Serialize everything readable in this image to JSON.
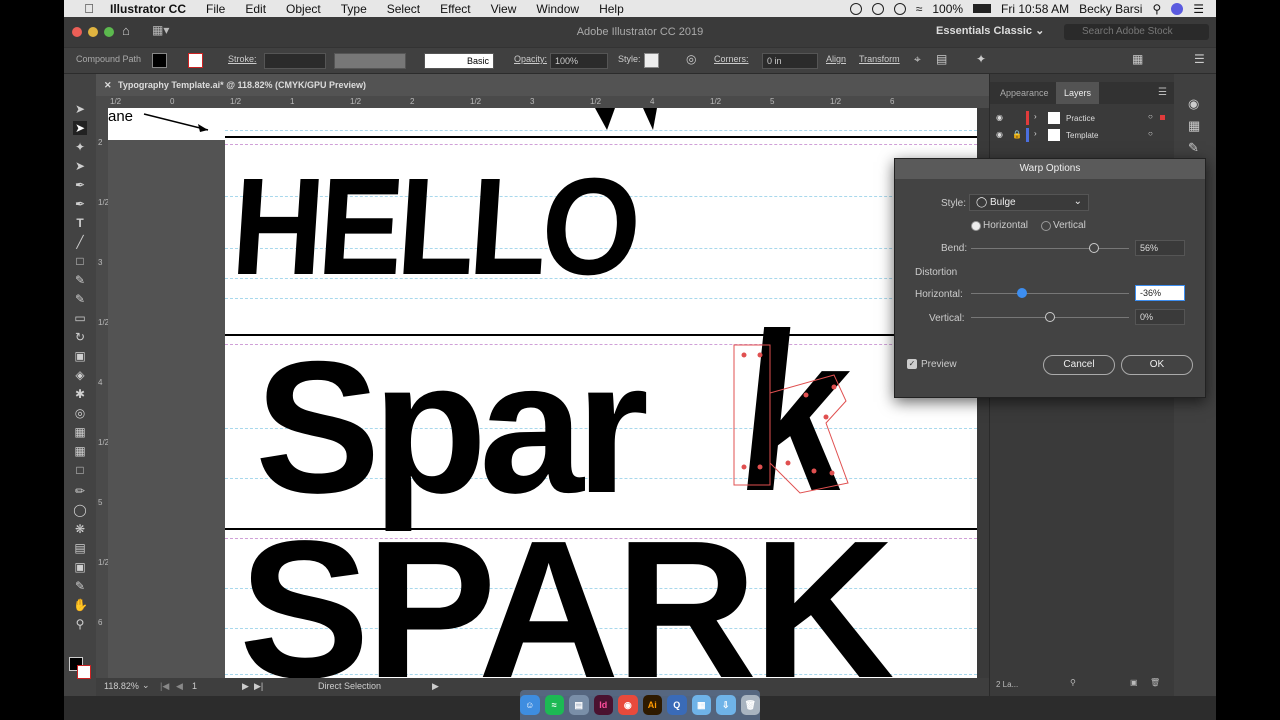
{
  "menubar": {
    "app": "Illustrator CC",
    "items": [
      "File",
      "Edit",
      "Object",
      "Type",
      "Select",
      "Effect",
      "View",
      "Window",
      "Help"
    ],
    "battery": "100%",
    "time": "Fri 10:58 AM",
    "user": "Becky Barsi"
  },
  "window": {
    "title": "Adobe Illustrator CC 2019",
    "workspace": "Essentials Classic",
    "search_placeholder": "Search Adobe Stock"
  },
  "controlbar": {
    "selection": "Compound Path",
    "stroke_label": "Stroke:",
    "brush": "Basic",
    "opacity_label": "Opacity:",
    "opacity": "100%",
    "style_label": "Style:",
    "corners_label": "Corners:",
    "corners": "0 in",
    "align": "Align",
    "transform": "Transform"
  },
  "document": {
    "tab": "Typography Template.ai* @ 118.82% (CMYK/GPU Preview)",
    "artboard_label": "ane",
    "words": [
      "HELLO",
      "Spar",
      "k",
      "SPARK"
    ]
  },
  "ruler_top": [
    "1/2",
    "0",
    "1/2",
    "1",
    "1/2",
    "2",
    "1/2",
    "3",
    "1/2",
    "4",
    "1/2",
    "5",
    "1/2",
    "6"
  ],
  "ruler_left": [
    "2",
    "1/2",
    "3",
    "1/2",
    "4",
    "1/2",
    "5",
    "1/2",
    "6"
  ],
  "statusbar": {
    "zoom": "118.82%",
    "page": "1",
    "tool": "Direct Selection",
    "layers_count": "2 La..."
  },
  "panel": {
    "tabs": [
      "Appearance",
      "Layers"
    ],
    "active_tab": "Layers",
    "layers": [
      {
        "name": "Practice",
        "color": "#e03b3b"
      },
      {
        "name": "Template",
        "color": "#4b6fe0"
      }
    ]
  },
  "warp": {
    "title": "Warp Options",
    "style_label": "Style:",
    "style": "Bulge",
    "horizontal": "Horizontal",
    "vertical": "Vertical",
    "orientation": "Horizontal",
    "bend_label": "Bend:",
    "bend": "56%",
    "bend_value": 0.78,
    "distortion": "Distortion",
    "dist_h_label": "Horizontal:",
    "dist_h": "-36%",
    "dist_h_value": 0.32,
    "dist_v_label": "Vertical:",
    "dist_v": "0%",
    "dist_v_value": 0.5,
    "preview": "Preview",
    "cancel": "Cancel",
    "ok": "OK"
  }
}
